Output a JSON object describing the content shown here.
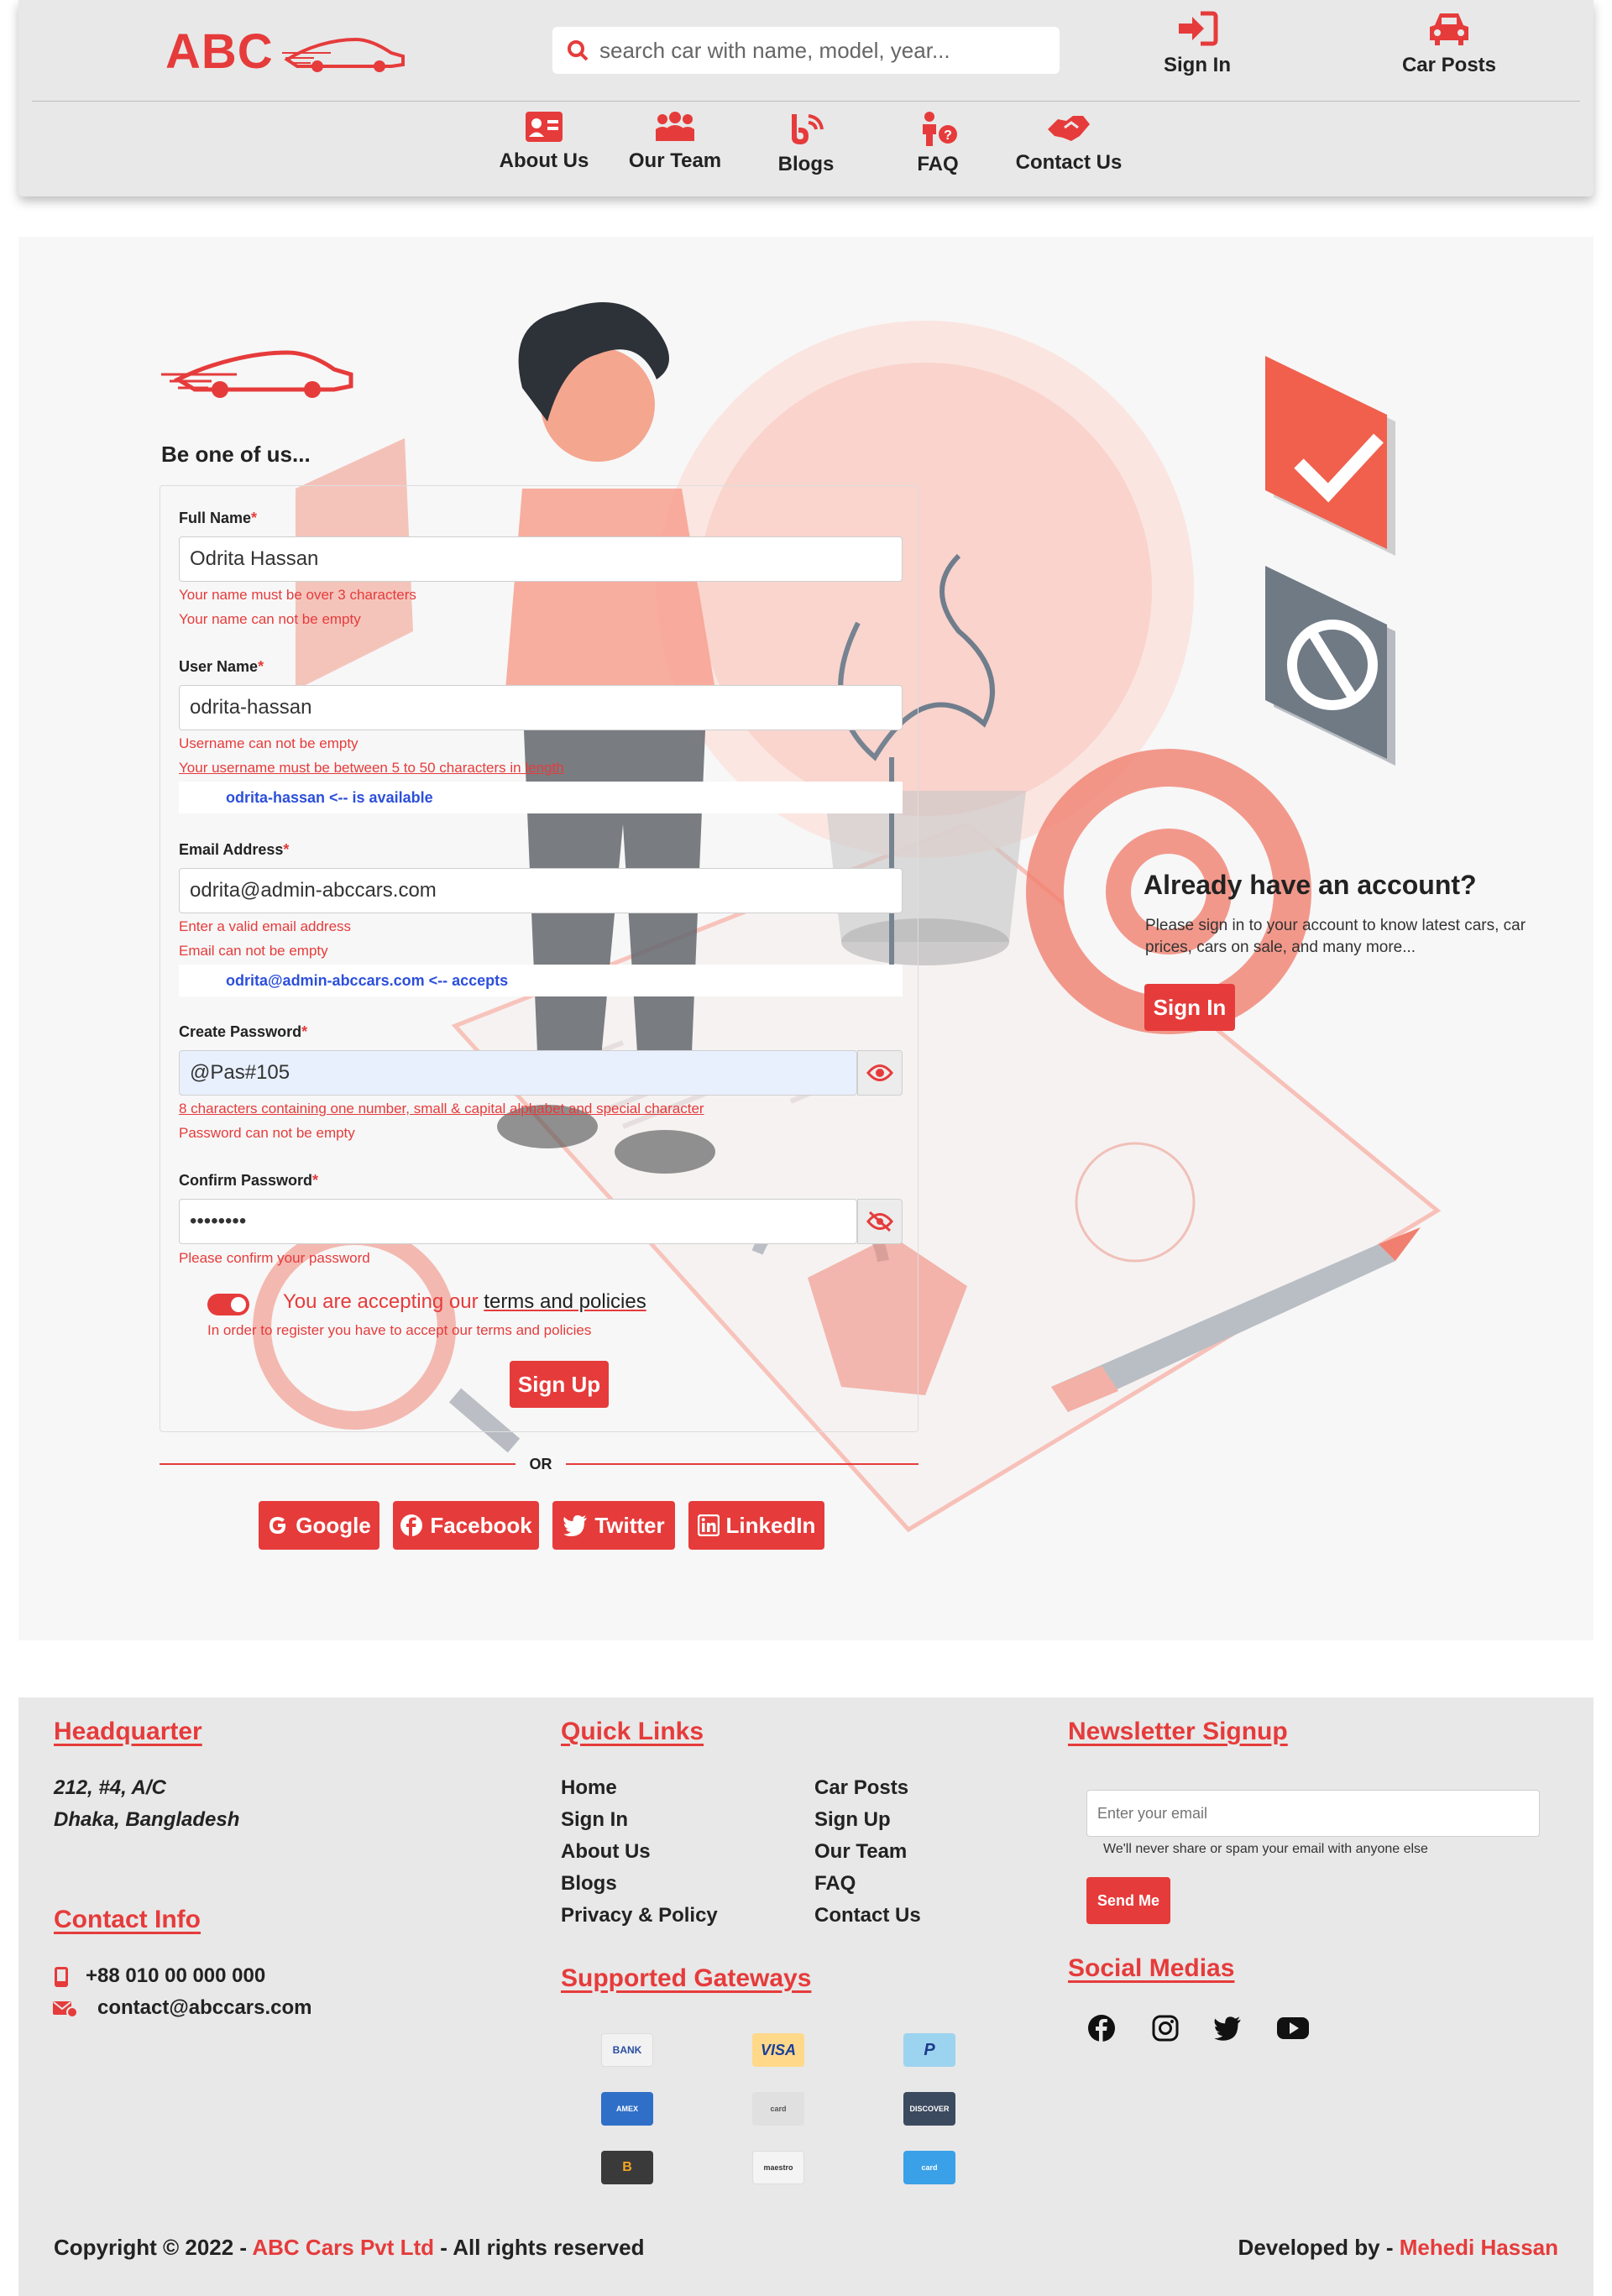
{
  "header": {
    "logo_text": "ABC",
    "search_placeholder": "search car with name, model, year...",
    "sign_in": "Sign In",
    "car_posts": "Car Posts",
    "nav": [
      {
        "label": "About Us",
        "icon": "id-card-icon"
      },
      {
        "label": "Our Team",
        "icon": "team-icon"
      },
      {
        "label": "Blogs",
        "icon": "blog-icon"
      },
      {
        "label": "FAQ",
        "icon": "faq-icon"
      },
      {
        "label": "Contact Us",
        "icon": "handshake-icon"
      }
    ]
  },
  "signup": {
    "heading": "Be one of us...",
    "full_name_label": "Full Name",
    "full_name_value": "Odrita Hassan",
    "full_name_err1": "Your name must be over 3 characters",
    "full_name_err2": "Your name can not be empty",
    "user_name_label": "User Name",
    "user_name_value": "odrita-hassan",
    "user_name_err1": "Username can not be empty",
    "user_name_err2": "Your username must be between 5 to 50 characters in length",
    "user_name_avail": "odrita-hassan <-- is available",
    "email_label": "Email Address",
    "email_value": "odrita@admin-abccars.com",
    "email_err1": "Enter a valid email address",
    "email_err2": "Email can not be empty",
    "email_avail": "odrita@admin-abccars.com <-- accepts",
    "password_label": "Create Password",
    "password_value": "@Pas#105",
    "password_err1": "8 characters containing one number, small & capital alphabet and special character",
    "password_err2": "Password can not be empty",
    "confirm_label": "Confirm Password",
    "confirm_value": "••••••••",
    "confirm_err": "Please confirm your password",
    "accept_text": "You are accepting our ",
    "accept_link": "terms and policies",
    "accept_err": "In order to register you have to accept our terms and policies",
    "signup_button": "Sign Up",
    "or": "OR",
    "social": [
      "Google",
      "Facebook",
      "Twitter",
      "LinkedIn"
    ]
  },
  "already": {
    "title": "Already have an account?",
    "text": "Please sign in to your account to know latest cars, car prices, cars on sale, and many more...",
    "button": "Sign In"
  },
  "footer": {
    "hq_title": "Headquarter",
    "hq_line1": "212, #4, A/C",
    "hq_line2": "Dhaka, Bangladesh",
    "contact_title": "Contact Info",
    "phone": "+88 010 00 000 000",
    "email": "contact@abccars.com",
    "quick_title": "Quick Links",
    "quick_col1": [
      "Home",
      "Sign In",
      "About Us",
      "Blogs",
      "Privacy & Policy"
    ],
    "quick_col2": [
      "Car Posts",
      "Sign Up",
      "Our Team",
      "FAQ",
      "Contact Us"
    ],
    "gateways_title": "Supported Gateways",
    "gateways": [
      "BANK",
      "VISA",
      "P",
      "AMEX",
      "card",
      "DISCOVER",
      "B",
      "maestro",
      "card"
    ],
    "news_title": "Newsletter Signup",
    "news_placeholder": "Enter your email",
    "news_help": "We'll never share or spam your email with anyone else",
    "news_button": "Send Me",
    "social_title": "Social Medias",
    "copy_prefix": "Copyright © 2022 - ",
    "copy_company": "ABC Cars Pvt Ltd",
    "copy_suffix": " - All rights reserved",
    "dev_prefix": "Developed by - ",
    "dev_name": "Mehedi Hassan"
  },
  "colors": {
    "accent": "#e63b3b",
    "header_bg": "#e8e8e8",
    "link_blue": "#2c4fdb"
  }
}
